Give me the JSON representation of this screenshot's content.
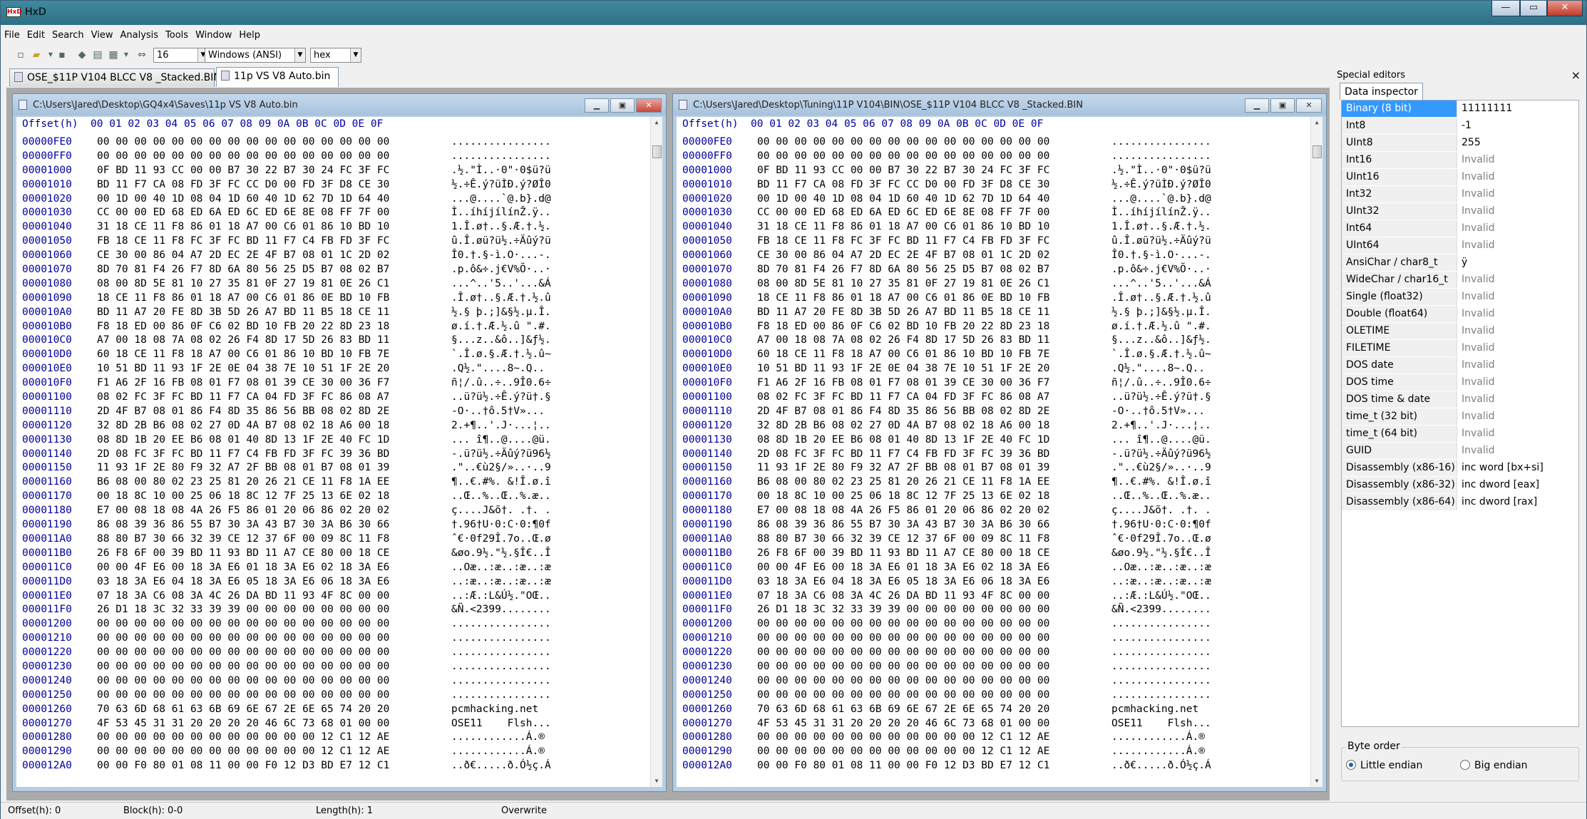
{
  "window": {
    "title": "HxD",
    "minimize": "—",
    "maximize": "▭",
    "close": "✕"
  },
  "menu": [
    "File",
    "Edit",
    "Search",
    "View",
    "Analysis",
    "Tools",
    "Window",
    "Help"
  ],
  "toolbar": {
    "bytes_per_row": "16",
    "charset": "Windows (ANSI)",
    "offset_base": "hex"
  },
  "tabs": [
    {
      "label": "OSE_$11P V104 BLCC V8 _Stacked.BIN",
      "active": false
    },
    {
      "label": "11p VS V8 Auto.bin",
      "active": true
    }
  ],
  "editors": [
    {
      "path": "C:\\Users\\Jared\\Desktop\\GQ4x4\\Saves\\11p VS V8 Auto.bin",
      "active": true
    },
    {
      "path": "C:\\Users\\Jared\\Desktop\\Tuning\\11P V104\\BIN\\OSE_$11P V104 BLCC V8 _Stacked.BIN",
      "active": false
    }
  ],
  "hex_header": "Offset(h)  00 01 02 03 04 05 06 07 08 09 0A 0B 0C 0D 0E 0F",
  "hex_rows": [
    {
      "off": "00000FE0",
      "hex": "00 00 00 00 00 00 00 00 00 00 00 00 00 00 00 00",
      "txt": "................"
    },
    {
      "off": "00000FF0",
      "hex": "00 00 00 00 00 00 00 00 00 00 00 00 00 00 00 00",
      "txt": "................"
    },
    {
      "off": "00001000",
      "hex": "0F BD 11 93 CC 00 00 B7 30 22 B7 30 24 FC 3F FC",
      "txt": ".½.\"Ì..·0\"·0$ü?ü"
    },
    {
      "off": "00001010",
      "hex": "BD 11 F7 CA 08 FD 3F FC CC D0 00 FD 3F D8 CE 30",
      "txt": "½.÷Ê.ý?üÌÐ.ý?ØÎ0"
    },
    {
      "off": "00001020",
      "hex": "00 1D 00 40 1D 08 04 1D 60 40 1D 62 7D 1D 64 40",
      "txt": "...@....`@.b}.d@"
    },
    {
      "off": "00001030",
      "hex": "CC 00 00 ED 68 ED 6A ED 6C ED 6E 8E 08 FF 7F 00",
      "txt": "Ì..íhíjílínŽ.ÿ.."
    },
    {
      "off": "00001040",
      "hex": "31 18 CE 11 F8 86 01 18 A7 00 C6 01 86 10 BD 10",
      "txt": "1.Î.ø†..§.Æ.†.½."
    },
    {
      "off": "00001050",
      "hex": "FB 18 CE 11 F8 FC 3F FC BD 11 F7 C4 FB FD 3F FC",
      "txt": "û.Î.øü?ü½.÷Äûý?ü"
    },
    {
      "off": "00001060",
      "cut": "",
      "hex": "CE 30 00 86 04 A7 2D EC 2E 4F B7 08 01 1C 2D 02",
      "txt": "Î0.†.§-ì.O·...-."
    },
    {
      "off": "00001070",
      "hex": "8D 70 81 F4 26 F7 8D 6A 80 56 25 D5 B7 08 02 B7",
      "txt": ".p.ô&÷.j€V%Õ·..·"
    },
    {
      "off": "00001080",
      "hex": "08 00 8D 5E 81 10 27 35 81 0F 27 19 81 0E 26 C1",
      "txt": "...^..'5..'...&Á"
    },
    {
      "off": "00001090",
      "hex": "18 CE 11 F8 86 01 18 A7 00 C6 01 86 0E BD 10 FB",
      "txt": ".Î.ø†..§.Æ.†.½.û"
    },
    {
      "off": "000010A0",
      "hex": "BD 11 A7 20 FE 8D 3B 5D 26 A7 BD 11 B5 18 CE 11",
      "txt": "½.§ þ.;]&§½.µ.Î."
    },
    {
      "off": "000010B0",
      "hex": "F8 18 ED 00 86 0F C6 02 BD 10 FB 20 22 8D 23 18",
      "txt": "ø.í.†.Æ.½.û \".#."
    },
    {
      "off": "000010C0",
      "hex": "A7 00 18 08 7A 08 02 26 F4 8D 17 5D 26 83 BD 11",
      "txt": "§...z..&ô..]&ƒ½."
    },
    {
      "off": "000010D0",
      "hex": "60 18 CE 11 F8 18 A7 00 C6 01 86 10 BD 10 FB 7E",
      "txt": "`.Î.ø.§.Æ.†.½.û~"
    },
    {
      "off": "000010E0",
      "hex": "10 51 BD 11 93 1F 2E 0E 04 38 7E 10 51 1F 2E 20",
      "txt": ".Q½.\"....8~.Q.. "
    },
    {
      "off": "000010F0",
      "hex": "F1 A6 2F 16 FB 08 01 F7 08 01 39 CE 30 00 36 F7",
      "txt": "ñ¦/.û..÷..9Î0.6÷"
    },
    {
      "off": "00001100",
      "hex": "08 02 FC 3F FC BD 11 F7 CA 04 FD 3F FC 86 08 A7",
      "txt": "..ü?ü½.÷Ê.ý?ü†.§"
    },
    {
      "off": "00001110",
      "hex": "2D 4F B7 08 01 86 F4 8D 35 86 56 BB 08 02 8D 2E",
      "txt": "-O·..†ô.5†V»..."
    },
    {
      "off": "00001120",
      "hex": "32 8D 2B B6 08 02 27 0D 4A B7 08 02 18 A6 00 18",
      "txt": "2.+¶..'.J·...¦.."
    },
    {
      "off": "00001130",
      "hex": "08 8D 1B 20 EE B6 08 01 40 8D 13 1F 2E 40 FC 1D",
      "txt": "... î¶..@....@ü."
    },
    {
      "off": "00001140",
      "hex": "2D 08 FC 3F FC BD 11 F7 C4 FB FD 3F FC 39 36 BD",
      "txt": "-.ü?ü½.÷Äûý?ü96½"
    },
    {
      "off": "00001150",
      "hex": "11 93 1F 2E 80 F9 32 A7 2F BB 08 01 B7 08 01 39",
      "txt": ".\"..€ù2§/»..·..9"
    },
    {
      "off": "00001160",
      "hex": "B6 08 00 80 02 23 25 81 20 26 21 CE 11 F8 1A EE",
      "txt": "¶..€.#%. &!Î.ø.î"
    },
    {
      "off": "00001170",
      "hex": "00 18 8C 10 00 25 06 18 8C 12 7F 25 13 6E 02 18",
      "txt": "..Œ..%..Œ..%.æ.."
    },
    {
      "off": "00001180",
      "hex": "E7 00 08 18 08 4A 26 F5 86 01 20 06 86 02 20 02",
      "txt": "ç....J&õ†. .†. ."
    },
    {
      "off": "00001190",
      "hex": "86 08 39 36 86 55 B7 30 3A 43 B7 30 3A B6 30 66",
      "txt": "†.96†U·0:C·0:¶0f"
    },
    {
      "off": "000011A0",
      "hex": "88 80 B7 30 66 32 39 CE 12 37 6F 00 09 8C 11 F8",
      "txt": "ˆ€·0f29Î.7o..Œ.ø"
    },
    {
      "off": "000011B0",
      "hex": "26 F8 6F 00 39 BD 11 93 BD 11 A7 CE 80 00 18 CE",
      "txt": "&øo.9½.\"½.§Î€..Î"
    },
    {
      "off": "000011C0",
      "hex": "00 00 4F E6 00 18 3A E6 01 18 3A E6 02 18 3A E6",
      "txt": "..Oæ..:æ..:æ..:æ"
    },
    {
      "off": "000011D0",
      "hex": "03 18 3A E6 04 18 3A E6 05 18 3A E6 06 18 3A E6",
      "txt": "..:æ..:æ..:æ..:æ"
    },
    {
      "off": "000011E0",
      "hex": "07 18 3A C6 08 3A 4C 26 DA BD 11 93 4F 8C 00 00",
      "txt": "..:Æ.:L&Ú½.\"OŒ.."
    },
    {
      "off": "000011F0",
      "hex": "26 D1 18 3C 32 33 39 39 00 00 00 00 00 00 00 00",
      "txt": "&Ñ.<2399........"
    },
    {
      "off": "00001200",
      "hex": "00 00 00 00 00 00 00 00 00 00 00 00 00 00 00 00",
      "txt": "................"
    },
    {
      "off": "00001210",
      "hex": "00 00 00 00 00 00 00 00 00 00 00 00 00 00 00 00",
      "txt": "................"
    },
    {
      "off": "00001220",
      "hex": "00 00 00 00 00 00 00 00 00 00 00 00 00 00 00 00",
      "txt": "................"
    },
    {
      "off": "00001230",
      "hex": "00 00 00 00 00 00 00 00 00 00 00 00 00 00 00 00",
      "txt": "................"
    },
    {
      "off": "00001240",
      "hex": "00 00 00 00 00 00 00 00 00 00 00 00 00 00 00 00",
      "txt": "................"
    },
    {
      "off": "00001250",
      "hex": "00 00 00 00 00 00 00 00 00 00 00 00 00 00 00 00",
      "txt": "................"
    },
    {
      "off": "00001260",
      "hex": "70 63 6D 68 61 63 6B 69 6E 67 2E 6E 65 74 20 20",
      "txt": "pcmhacking.net  "
    },
    {
      "off": "00001270",
      "hex": "4F 53 45 31 31 20 20 20 20 46 6C 73 68 01 00 00",
      "txt": "OSE11    Flsh..."
    },
    {
      "off": "00001280",
      "hex": "00 00 00 00 00 00 00 00 00 00 00 00 12 C1 12 AE",
      "txt": "............Á.®"
    },
    {
      "off": "00001290",
      "hex": "00 00 00 00 00 00 00 00 00 00 00 00 12 C1 12 AE",
      "txt": "............Á.®"
    },
    {
      "off": "000012A0",
      "hex": "00 00 F0 80 01 08 11 00 00 F0 12 D3 BD E7 12 C1",
      "txt": "..ð€.....ð.Ó½ç.Á"
    }
  ],
  "special_editors": {
    "title": "Special editors",
    "close": "×",
    "tab": "Data inspector"
  },
  "inspector": [
    {
      "k": "Binary (8 bit)",
      "v": "11111111",
      "invalid": false,
      "selected": true
    },
    {
      "k": "Int8",
      "v": "-1",
      "invalid": false
    },
    {
      "k": "UInt8",
      "v": "255",
      "invalid": false
    },
    {
      "k": "Int16",
      "v": "Invalid",
      "invalid": true
    },
    {
      "k": "UInt16",
      "v": "Invalid",
      "invalid": true
    },
    {
      "k": "Int32",
      "v": "Invalid",
      "invalid": true
    },
    {
      "k": "UInt32",
      "v": "Invalid",
      "invalid": true
    },
    {
      "k": "Int64",
      "v": "Invalid",
      "invalid": true
    },
    {
      "k": "UInt64",
      "v": "Invalid",
      "invalid": true
    },
    {
      "k": "AnsiChar / char8_t",
      "v": "ÿ",
      "invalid": false
    },
    {
      "k": "WideChar / char16_t",
      "v": "Invalid",
      "invalid": true
    },
    {
      "k": "Single (float32)",
      "v": "Invalid",
      "invalid": true
    },
    {
      "k": "Double (float64)",
      "v": "Invalid",
      "invalid": true
    },
    {
      "k": "OLETIME",
      "v": "Invalid",
      "invalid": true
    },
    {
      "k": "FILETIME",
      "v": "Invalid",
      "invalid": true
    },
    {
      "k": "DOS date",
      "v": "Invalid",
      "invalid": true
    },
    {
      "k": "DOS time",
      "v": "Invalid",
      "invalid": true
    },
    {
      "k": "DOS time & date",
      "v": "Invalid",
      "invalid": true
    },
    {
      "k": "time_t (32 bit)",
      "v": "Invalid",
      "invalid": true
    },
    {
      "k": "time_t (64 bit)",
      "v": "Invalid",
      "invalid": true
    },
    {
      "k": "GUID",
      "v": "Invalid",
      "invalid": true
    },
    {
      "k": "Disassembly (x86-16)",
      "v": "inc word [bx+si]",
      "invalid": false
    },
    {
      "k": "Disassembly (x86-32)",
      "v": "inc dword [eax]",
      "invalid": false
    },
    {
      "k": "Disassembly (x86-64)",
      "v": "inc dword [rax]",
      "invalid": false
    }
  ],
  "byte_order": {
    "label": "Byte order",
    "little": "Little endian",
    "big": "Big endian",
    "selected": "little"
  },
  "status": {
    "offset": "Offset(h): 0",
    "block": "Block(h): 0-0",
    "length": "Length(h): 1",
    "mode": "Overwrite"
  }
}
